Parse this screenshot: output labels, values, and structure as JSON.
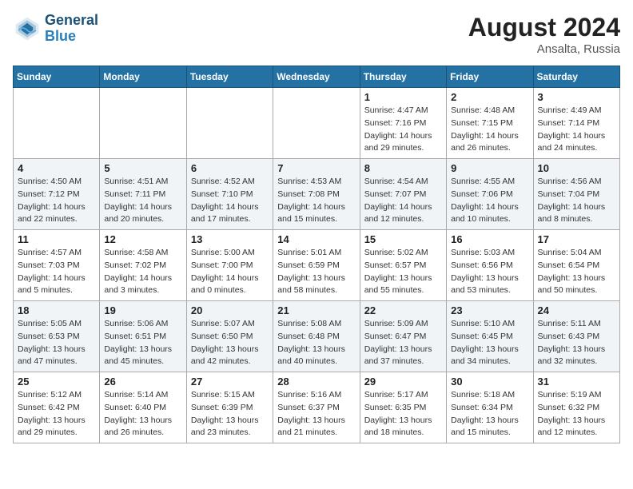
{
  "logo": {
    "text_general": "General",
    "text_blue": "Blue"
  },
  "title": {
    "month_year": "August 2024",
    "location": "Ansalta, Russia"
  },
  "weekdays": [
    "Sunday",
    "Monday",
    "Tuesday",
    "Wednesday",
    "Thursday",
    "Friday",
    "Saturday"
  ],
  "weeks": [
    [
      {
        "day": "",
        "sunrise": "",
        "sunset": "",
        "daylight": ""
      },
      {
        "day": "",
        "sunrise": "",
        "sunset": "",
        "daylight": ""
      },
      {
        "day": "",
        "sunrise": "",
        "sunset": "",
        "daylight": ""
      },
      {
        "day": "",
        "sunrise": "",
        "sunset": "",
        "daylight": ""
      },
      {
        "day": "1",
        "sunrise": "Sunrise: 4:47 AM",
        "sunset": "Sunset: 7:16 PM",
        "daylight": "Daylight: 14 hours and 29 minutes."
      },
      {
        "day": "2",
        "sunrise": "Sunrise: 4:48 AM",
        "sunset": "Sunset: 7:15 PM",
        "daylight": "Daylight: 14 hours and 26 minutes."
      },
      {
        "day": "3",
        "sunrise": "Sunrise: 4:49 AM",
        "sunset": "Sunset: 7:14 PM",
        "daylight": "Daylight: 14 hours and 24 minutes."
      }
    ],
    [
      {
        "day": "4",
        "sunrise": "Sunrise: 4:50 AM",
        "sunset": "Sunset: 7:12 PM",
        "daylight": "Daylight: 14 hours and 22 minutes."
      },
      {
        "day": "5",
        "sunrise": "Sunrise: 4:51 AM",
        "sunset": "Sunset: 7:11 PM",
        "daylight": "Daylight: 14 hours and 20 minutes."
      },
      {
        "day": "6",
        "sunrise": "Sunrise: 4:52 AM",
        "sunset": "Sunset: 7:10 PM",
        "daylight": "Daylight: 14 hours and 17 minutes."
      },
      {
        "day": "7",
        "sunrise": "Sunrise: 4:53 AM",
        "sunset": "Sunset: 7:08 PM",
        "daylight": "Daylight: 14 hours and 15 minutes."
      },
      {
        "day": "8",
        "sunrise": "Sunrise: 4:54 AM",
        "sunset": "Sunset: 7:07 PM",
        "daylight": "Daylight: 14 hours and 12 minutes."
      },
      {
        "day": "9",
        "sunrise": "Sunrise: 4:55 AM",
        "sunset": "Sunset: 7:06 PM",
        "daylight": "Daylight: 14 hours and 10 minutes."
      },
      {
        "day": "10",
        "sunrise": "Sunrise: 4:56 AM",
        "sunset": "Sunset: 7:04 PM",
        "daylight": "Daylight: 14 hours and 8 minutes."
      }
    ],
    [
      {
        "day": "11",
        "sunrise": "Sunrise: 4:57 AM",
        "sunset": "Sunset: 7:03 PM",
        "daylight": "Daylight: 14 hours and 5 minutes."
      },
      {
        "day": "12",
        "sunrise": "Sunrise: 4:58 AM",
        "sunset": "Sunset: 7:02 PM",
        "daylight": "Daylight: 14 hours and 3 minutes."
      },
      {
        "day": "13",
        "sunrise": "Sunrise: 5:00 AM",
        "sunset": "Sunset: 7:00 PM",
        "daylight": "Daylight: 14 hours and 0 minutes."
      },
      {
        "day": "14",
        "sunrise": "Sunrise: 5:01 AM",
        "sunset": "Sunset: 6:59 PM",
        "daylight": "Daylight: 13 hours and 58 minutes."
      },
      {
        "day": "15",
        "sunrise": "Sunrise: 5:02 AM",
        "sunset": "Sunset: 6:57 PM",
        "daylight": "Daylight: 13 hours and 55 minutes."
      },
      {
        "day": "16",
        "sunrise": "Sunrise: 5:03 AM",
        "sunset": "Sunset: 6:56 PM",
        "daylight": "Daylight: 13 hours and 53 minutes."
      },
      {
        "day": "17",
        "sunrise": "Sunrise: 5:04 AM",
        "sunset": "Sunset: 6:54 PM",
        "daylight": "Daylight: 13 hours and 50 minutes."
      }
    ],
    [
      {
        "day": "18",
        "sunrise": "Sunrise: 5:05 AM",
        "sunset": "Sunset: 6:53 PM",
        "daylight": "Daylight: 13 hours and 47 minutes."
      },
      {
        "day": "19",
        "sunrise": "Sunrise: 5:06 AM",
        "sunset": "Sunset: 6:51 PM",
        "daylight": "Daylight: 13 hours and 45 minutes."
      },
      {
        "day": "20",
        "sunrise": "Sunrise: 5:07 AM",
        "sunset": "Sunset: 6:50 PM",
        "daylight": "Daylight: 13 hours and 42 minutes."
      },
      {
        "day": "21",
        "sunrise": "Sunrise: 5:08 AM",
        "sunset": "Sunset: 6:48 PM",
        "daylight": "Daylight: 13 hours and 40 minutes."
      },
      {
        "day": "22",
        "sunrise": "Sunrise: 5:09 AM",
        "sunset": "Sunset: 6:47 PM",
        "daylight": "Daylight: 13 hours and 37 minutes."
      },
      {
        "day": "23",
        "sunrise": "Sunrise: 5:10 AM",
        "sunset": "Sunset: 6:45 PM",
        "daylight": "Daylight: 13 hours and 34 minutes."
      },
      {
        "day": "24",
        "sunrise": "Sunrise: 5:11 AM",
        "sunset": "Sunset: 6:43 PM",
        "daylight": "Daylight: 13 hours and 32 minutes."
      }
    ],
    [
      {
        "day": "25",
        "sunrise": "Sunrise: 5:12 AM",
        "sunset": "Sunset: 6:42 PM",
        "daylight": "Daylight: 13 hours and 29 minutes."
      },
      {
        "day": "26",
        "sunrise": "Sunrise: 5:14 AM",
        "sunset": "Sunset: 6:40 PM",
        "daylight": "Daylight: 13 hours and 26 minutes."
      },
      {
        "day": "27",
        "sunrise": "Sunrise: 5:15 AM",
        "sunset": "Sunset: 6:39 PM",
        "daylight": "Daylight: 13 hours and 23 minutes."
      },
      {
        "day": "28",
        "sunrise": "Sunrise: 5:16 AM",
        "sunset": "Sunset: 6:37 PM",
        "daylight": "Daylight: 13 hours and 21 minutes."
      },
      {
        "day": "29",
        "sunrise": "Sunrise: 5:17 AM",
        "sunset": "Sunset: 6:35 PM",
        "daylight": "Daylight: 13 hours and 18 minutes."
      },
      {
        "day": "30",
        "sunrise": "Sunrise: 5:18 AM",
        "sunset": "Sunset: 6:34 PM",
        "daylight": "Daylight: 13 hours and 15 minutes."
      },
      {
        "day": "31",
        "sunrise": "Sunrise: 5:19 AM",
        "sunset": "Sunset: 6:32 PM",
        "daylight": "Daylight: 13 hours and 12 minutes."
      }
    ]
  ]
}
